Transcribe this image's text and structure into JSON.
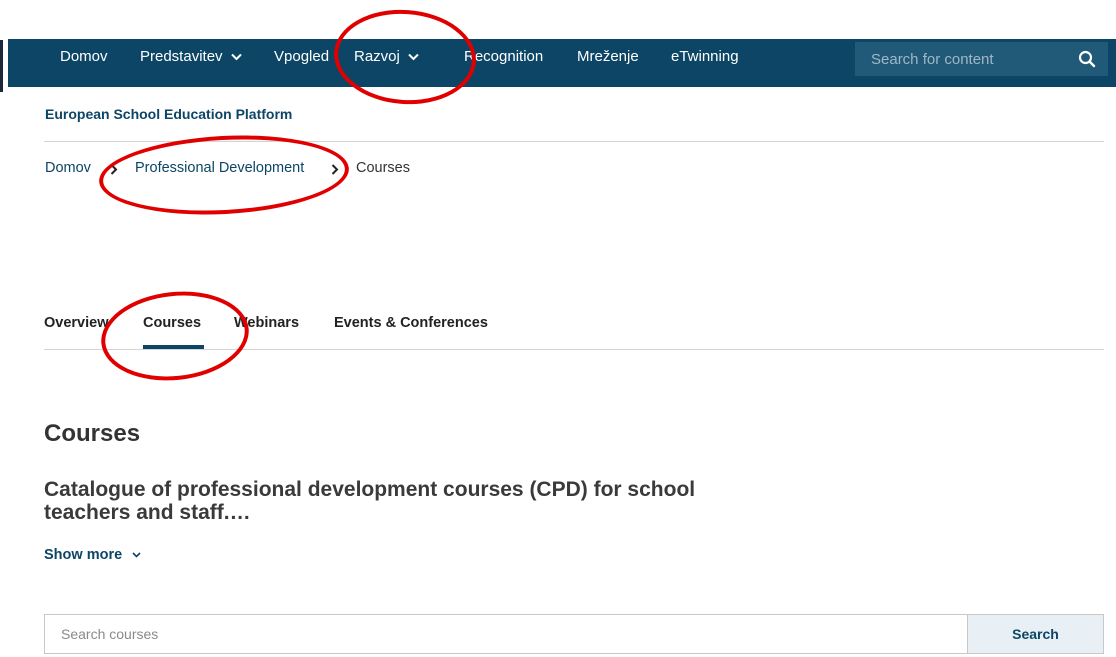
{
  "nav": {
    "items": [
      {
        "label": "Domov"
      },
      {
        "label": "Predstavitev",
        "has_dropdown": true
      },
      {
        "label": "Vpogled"
      },
      {
        "label": "Razvoj",
        "has_dropdown": true
      },
      {
        "label": "Recognition"
      },
      {
        "label": "Mreženje"
      },
      {
        "label": "eTwinning"
      }
    ],
    "search_placeholder": "Search for content",
    "search_icon": "search-icon",
    "background_color": "#0c4565"
  },
  "site": {
    "title": "European School Education Platform"
  },
  "breadcrumb": {
    "items": [
      {
        "label": "Domov"
      },
      {
        "label": "Professional Development"
      }
    ],
    "current": "Courses"
  },
  "tabs": [
    {
      "label": "Overview",
      "active": false
    },
    {
      "label": "Courses",
      "active": true
    },
    {
      "label": "Webinars",
      "active": false
    },
    {
      "label": "Events & Conferences",
      "active": false
    }
  ],
  "page": {
    "heading": "Courses",
    "description": "Catalogue of professional development courses (CPD) for school teachers and staff.…",
    "show_more": "Show more"
  },
  "course_search": {
    "placeholder": "Search courses",
    "button": "Search"
  },
  "annotations": {
    "color": "#e00000",
    "circled": [
      "Razvoj",
      "Professional Development",
      "Courses"
    ]
  }
}
